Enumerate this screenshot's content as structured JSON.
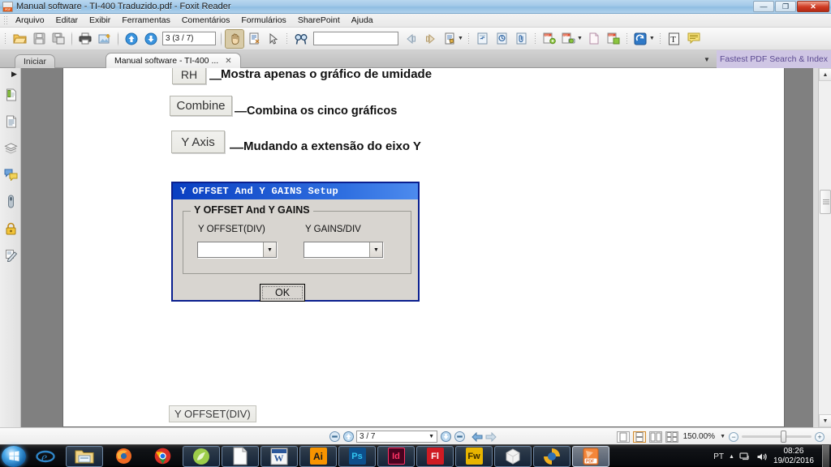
{
  "window": {
    "title": "Manual software - TI-400 Traduzido.pdf - Foxit Reader",
    "app_icon": "pdf-document-icon",
    "ghost_title": "",
    "minimize": "—",
    "maximize": "❐",
    "close": "✕"
  },
  "menubar": {
    "items": [
      "Arquivo",
      "Editar",
      "Exibir",
      "Ferramentas",
      "Comentários",
      "Formulários",
      "SharePoint",
      "Ajuda"
    ]
  },
  "toolbar": {
    "page_value": "3 (3 / 7)",
    "search_value": "",
    "icons": [
      {
        "name": "open-file-icon",
        "glyph": "📁"
      },
      {
        "name": "save-icon",
        "glyph": "💾"
      },
      {
        "name": "save-as-icon",
        "glyph": "💾"
      },
      {
        "name": "print-icon",
        "glyph": "🖨"
      },
      {
        "name": "snapshot-icon",
        "glyph": "🖼"
      },
      {
        "name": "previous-page-icon",
        "glyph": "↑"
      },
      {
        "name": "next-page-icon",
        "glyph": "↓"
      },
      {
        "name": "hand-tool-icon",
        "glyph": "✋"
      },
      {
        "name": "select-text-icon",
        "glyph": "📄"
      },
      {
        "name": "select-annotation-icon",
        "glyph": "➤"
      },
      {
        "name": "find-icon",
        "glyph": "🔍"
      },
      {
        "name": "previous-view-icon",
        "glyph": "◀"
      },
      {
        "name": "next-view-icon",
        "glyph": "▶"
      },
      {
        "name": "typewriter-icon",
        "glyph": "📝"
      },
      {
        "name": "link-icon",
        "glyph": "🔗"
      },
      {
        "name": "stamp-icon",
        "glyph": "◎"
      },
      {
        "name": "attach-file-icon",
        "glyph": "📎"
      },
      {
        "name": "create-pdf-icon",
        "glyph": "PDF"
      },
      {
        "name": "pdf-from-scanner-icon",
        "glyph": "PDF"
      },
      {
        "name": "combine-pdf-icon",
        "glyph": "PDF"
      },
      {
        "name": "blank-page-icon",
        "glyph": "⬜"
      },
      {
        "name": "pdf-export-icon",
        "glyph": "PDF"
      },
      {
        "name": "spelling-icon",
        "glyph": "↺"
      },
      {
        "name": "text-box-icon",
        "glyph": "T"
      },
      {
        "name": "note-icon",
        "glyph": "💬"
      }
    ]
  },
  "tabs": {
    "items": [
      {
        "label": "Iniciar",
        "active": false,
        "closable": false
      },
      {
        "label": "Manual software - TI-400 ...",
        "active": true,
        "closable": true
      }
    ],
    "close_glyph": "✕",
    "overflow_glyph": "▼",
    "promo_text": "Fastest PDF Search & Index"
  },
  "left_panel": {
    "collapse_glyph": "▶",
    "items": [
      {
        "name": "bookmarks-panel-icon",
        "glyph": "🔖"
      },
      {
        "name": "pages-thumbnails-panel-icon",
        "glyph": "📄"
      },
      {
        "name": "layers-panel-icon",
        "glyph": "◰"
      },
      {
        "name": "comments-panel-icon",
        "glyph": "💬"
      },
      {
        "name": "attachments-panel-icon",
        "glyph": "📎"
      },
      {
        "name": "security-panel-icon",
        "glyph": "🔒"
      },
      {
        "name": "signatures-panel-icon",
        "glyph": "✎"
      }
    ]
  },
  "document": {
    "rows": [
      {
        "button": "RH",
        "description": "Mostra apenas o gráfico de umidade"
      },
      {
        "button": "Combine",
        "description": "Combina os cinco gráficos"
      },
      {
        "button": "Y Axis",
        "description": "Mudando a extensão do eixo Y"
      }
    ],
    "dash": "—",
    "dialog": {
      "title": "Y OFFSET And Y GAINS Setup",
      "group_legend": "Y OFFSET And Y GAINS",
      "field_left_label": "Y OFFSET(DIV)",
      "field_right_label": "Y GAINS/DIV",
      "field_left_value": "",
      "field_right_value": "",
      "dropdown_glyph": "▼",
      "ok_label": "OK"
    },
    "bottom_label": "Y OFFSET(DIV)"
  },
  "statusbar": {
    "page_value": "3 / 7",
    "dropdown_glyph": "▼",
    "zoom_value": "150.00%",
    "zoom_out": "−",
    "zoom_in": "+",
    "nav_icons": [
      {
        "name": "first-page-icon",
        "glyph": "⏮"
      },
      {
        "name": "previous-page-icon",
        "glyph": "▲"
      },
      {
        "name": "next-page-icon",
        "glyph": "▼"
      },
      {
        "name": "last-page-icon",
        "glyph": "⏭"
      },
      {
        "name": "previous-view-icon",
        "glyph": "←"
      },
      {
        "name": "next-view-icon",
        "glyph": "→"
      }
    ],
    "view_modes": [
      {
        "name": "single-page-view-button",
        "selected": false
      },
      {
        "name": "continuous-view-button",
        "selected": true
      },
      {
        "name": "facing-view-button",
        "selected": false
      },
      {
        "name": "continuous-facing-view-button",
        "selected": false
      }
    ]
  },
  "taskbar": {
    "start_name": "start-button",
    "buttons": [
      {
        "name": "taskbar-internet-explorer",
        "label": "e",
        "bg": "none",
        "color": "#3aa0e0",
        "state": "pinned"
      },
      {
        "name": "taskbar-windows-explorer",
        "label": "📁",
        "bg": "none",
        "color": "#e6c05a",
        "state": "open"
      },
      {
        "name": "taskbar-firefox",
        "label": "🦊",
        "bg": "none",
        "color": "#e8712a",
        "state": "pinned"
      },
      {
        "name": "taskbar-chrome",
        "label": "◉",
        "bg": "none",
        "color": "#3bb44a",
        "state": "pinned"
      },
      {
        "name": "taskbar-foxit-phantom",
        "label": "🍃",
        "bg": "none",
        "color": "#8bc53f",
        "state": "open"
      },
      {
        "name": "taskbar-libreoffice-writer",
        "label": "📄",
        "bg": "none",
        "color": "#f2f2f2",
        "state": "open"
      },
      {
        "name": "taskbar-microsoft-word",
        "label": "W",
        "bg": "#2b579a",
        "color": "#ffffff",
        "state": "open"
      },
      {
        "name": "taskbar-adobe-illustrator",
        "label": "Ai",
        "bg": "#f79400",
        "color": "#1a1a1a",
        "state": "open"
      },
      {
        "name": "taskbar-adobe-photoshop",
        "label": "Ps",
        "bg": "#0d4f8b",
        "color": "#31c5f0",
        "state": "open"
      },
      {
        "name": "taskbar-adobe-indesign",
        "label": "Id",
        "bg": "#49021f",
        "color": "#ff3366",
        "state": "open"
      },
      {
        "name": "taskbar-adobe-flash",
        "label": "Fl",
        "bg": "#cf1b23",
        "color": "#ffffff",
        "state": "open"
      },
      {
        "name": "taskbar-adobe-fireworks",
        "label": "Fw",
        "bg": "#e8b500",
        "color": "#3a2c00",
        "state": "open"
      },
      {
        "name": "taskbar-sketchup",
        "label": "⬛",
        "bg": "none",
        "color": "#e8e8e8",
        "state": "open"
      },
      {
        "name": "taskbar-foxit-phantompdf",
        "label": "◕",
        "bg": "none",
        "color": "#f2b01e",
        "state": "open"
      },
      {
        "name": "taskbar-foxit-reader",
        "label": "PDF",
        "bg": "#f4863a",
        "color": "#ffffff",
        "state": "current"
      }
    ],
    "tray": {
      "language": "PT",
      "show_hidden_glyph": "▲",
      "network_icon": "network-icon",
      "volume_icon": "volume-icon",
      "time": "08:26",
      "date": "19/02/2016"
    }
  }
}
